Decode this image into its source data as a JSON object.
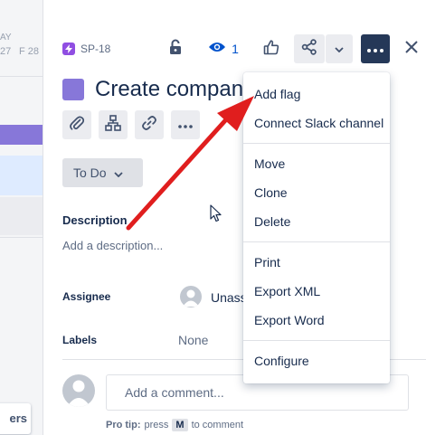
{
  "calendar": {
    "day_label": "AY",
    "dates": [
      "27",
      "F 28"
    ]
  },
  "left_button_label": "ers",
  "issue": {
    "key": "SP-18",
    "title": "Create company",
    "watch_count": "1",
    "status": "To Do",
    "description_label": "Description",
    "description_placeholder": "Add a description...",
    "assignee_label": "Assignee",
    "assignee_value": "Unass",
    "labels_label": "Labels",
    "labels_value": "None"
  },
  "comment": {
    "placeholder": "Add a comment...",
    "pro_tip_label": "Pro tip:",
    "pro_tip_press": "press",
    "pro_tip_key": "M",
    "pro_tip_suffix": "to comment"
  },
  "menu": {
    "items": [
      "Add flag",
      "Connect Slack channel",
      "Move",
      "Clone",
      "Delete",
      "Print",
      "Export XML",
      "Export Word",
      "Configure"
    ]
  },
  "icons": {
    "key_icon": "lightning-icon",
    "lock": "lock-icon",
    "watch": "eye-icon",
    "like": "thumbs-up-icon",
    "share": "share-icon",
    "more": "more-icon",
    "close": "close-icon",
    "attach": "paperclip-icon",
    "child": "hierarchy-icon",
    "link": "link-icon",
    "annotation": "red-arrow"
  },
  "colors": {
    "accent": "#0052cc",
    "issue_type": "#8777d9",
    "more_button": "#253858",
    "arrow": "#e01e1e"
  }
}
